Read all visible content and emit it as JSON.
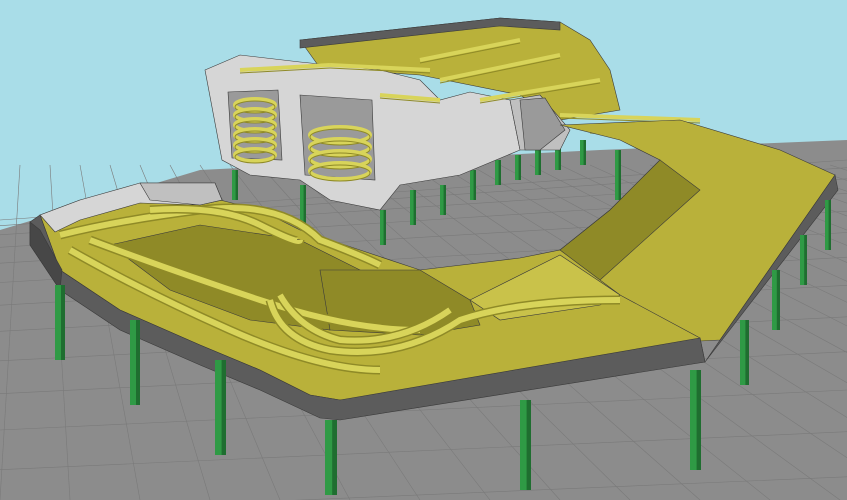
{
  "scene": {
    "kind": "3d-structural-model-render",
    "colors": {
      "sky": "#a9dde8",
      "ground": "#8c8c8c",
      "ground_grid": "#7a7a7a",
      "slab_top": "#b9b13a",
      "slab_top_light": "#c9c24a",
      "slab_top_dark": "#8f8a27",
      "slab_edge": "#5c5c5c",
      "slab_edge_dark": "#474747",
      "wall_light": "#d6d6d6",
      "wall_mid": "#c0c0c0",
      "wall_dark": "#9a9a9a",
      "column": "#2f9a45",
      "column_dark": "#1f6e30",
      "ramp": "#d8d45a",
      "ramp_edge": "#8f8a27"
    }
  }
}
